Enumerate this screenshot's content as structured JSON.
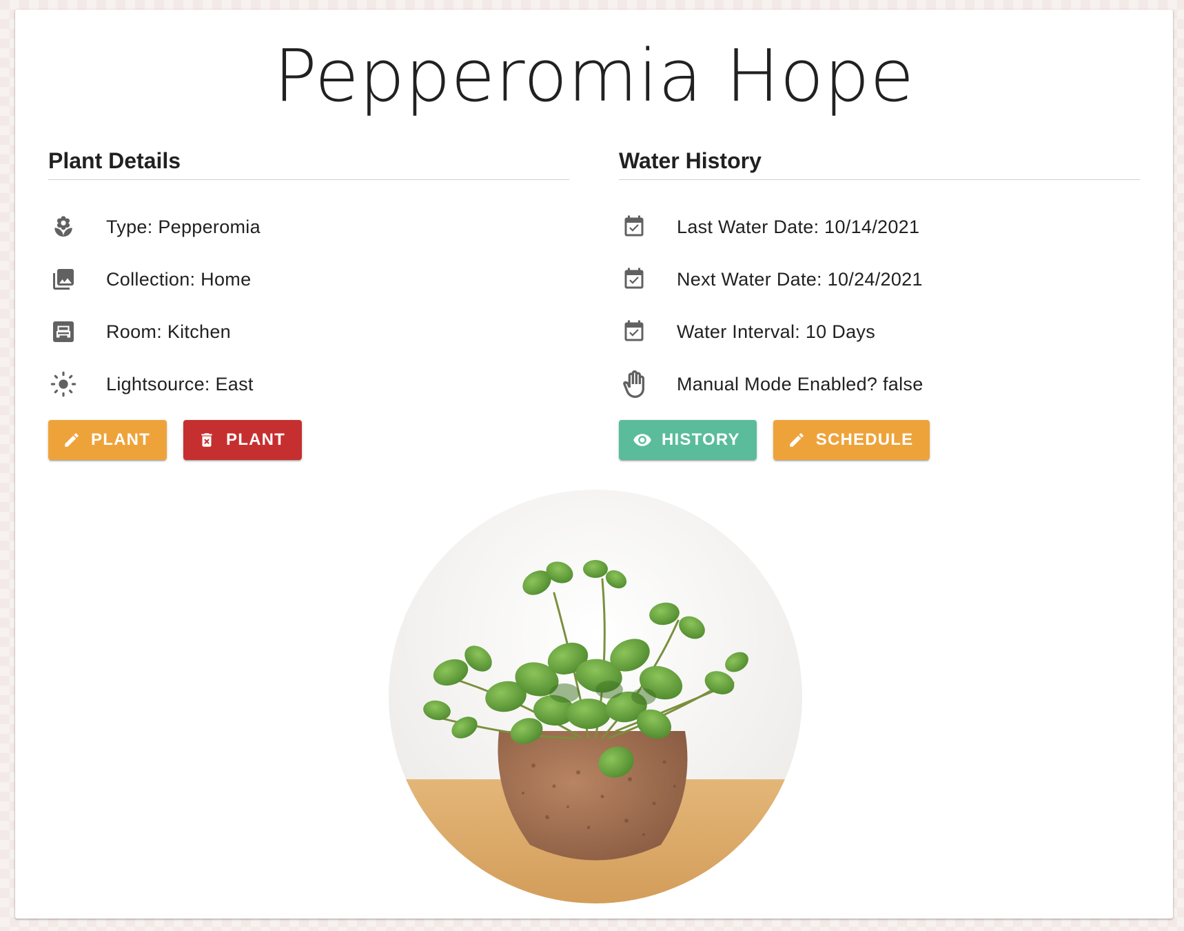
{
  "page": {
    "title": "Pepperomia Hope"
  },
  "plant_details": {
    "heading": "Plant Details",
    "rows": [
      {
        "icon": "flower-icon",
        "text": "Type: Pepperomia"
      },
      {
        "icon": "collection-icon",
        "text": "Collection: Home"
      },
      {
        "icon": "bed-icon",
        "text": "Room: Kitchen"
      },
      {
        "icon": "sun-icon",
        "text": "Lightsource: East"
      }
    ],
    "buttons": {
      "edit_label": "PLANT",
      "delete_label": "PLANT"
    }
  },
  "water_history": {
    "heading": "Water History",
    "rows": [
      {
        "icon": "calendar-check-icon",
        "text": "Last Water Date: 10/14/2021"
      },
      {
        "icon": "calendar-check-icon",
        "text": "Next Water Date: 10/24/2021"
      },
      {
        "icon": "calendar-check-icon",
        "text": "Water Interval: 10 Days"
      },
      {
        "icon": "hand-icon",
        "text": "Manual Mode Enabled? false"
      }
    ],
    "buttons": {
      "history_label": "HISTORY",
      "schedule_label": "SCHEDULE"
    }
  },
  "colors": {
    "orange": "#eea33a",
    "red": "#c62f2f",
    "teal": "#5bbc9c",
    "icon_gray": "#616161"
  }
}
